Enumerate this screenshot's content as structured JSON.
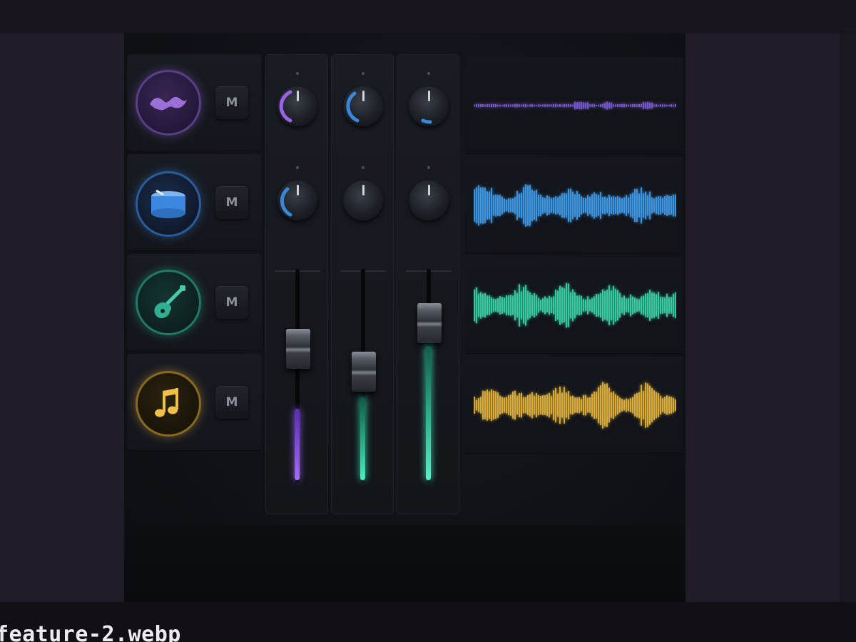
{
  "caption": {
    "filename": "feature-2.webp"
  },
  "tracks": [
    {
      "name": "synth-track",
      "icon": "wave-blob-icon",
      "color": "#8b5fc9",
      "mute_label": "M"
    },
    {
      "name": "drums-track",
      "icon": "drum-icon",
      "color": "#3b7fd1",
      "mute_label": "M"
    },
    {
      "name": "guitar-track",
      "icon": "guitar-icon",
      "color": "#2fae92",
      "mute_label": "M"
    },
    {
      "name": "music-track",
      "icon": "music-note-icon",
      "color": "#d8a23a",
      "mute_label": "M"
    }
  ],
  "channels": [
    {
      "knob1_color": "#9b63e6",
      "knob2_color": "#3a86d8",
      "level_color": "#8e55e8",
      "fader_level": 0.55,
      "meter_level": 0.34
    },
    {
      "knob1_color": "#3a86d8",
      "knob2_color": "#7c818c",
      "level_color": "#35d6a6",
      "fader_level": 0.45,
      "meter_level": 0.4
    },
    {
      "knob1_color": "#3a86d8",
      "knob2_color": "#7c818c",
      "level_color": "#3fe0b4",
      "fader_level": 0.78,
      "meter_level": 0.62
    }
  ],
  "waveforms": [
    {
      "color": "#7b5bd6",
      "style": "flat"
    },
    {
      "color": "#3f9ae8",
      "style": "full"
    },
    {
      "color": "#38d1a6",
      "style": "full"
    },
    {
      "color": "#e0b13c",
      "style": "full"
    }
  ]
}
